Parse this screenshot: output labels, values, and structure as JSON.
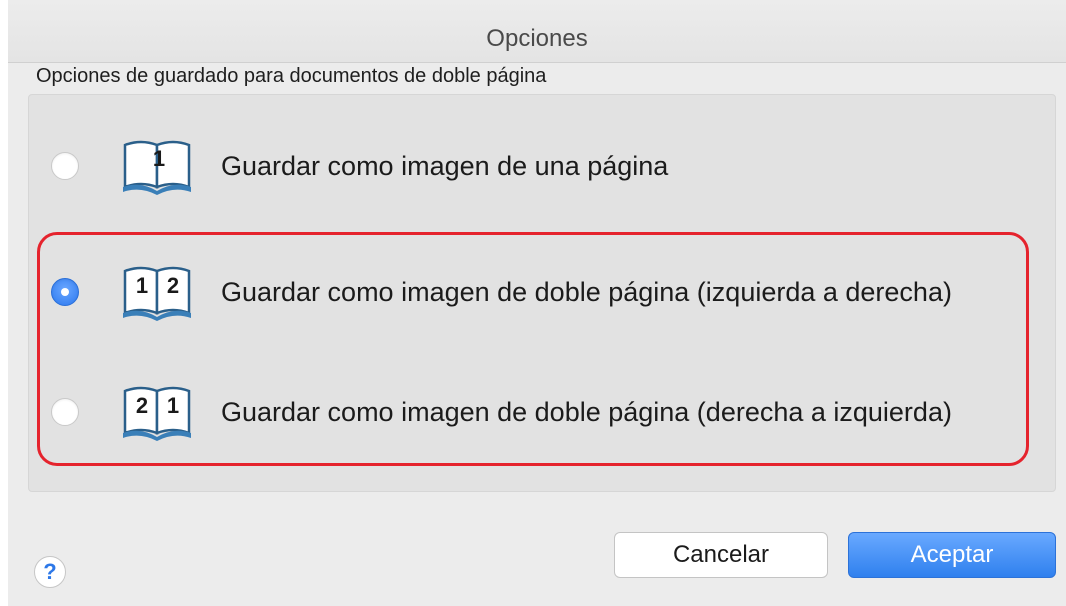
{
  "window": {
    "title": "Opciones"
  },
  "group": {
    "label": "Opciones de guardado para documentos de doble página"
  },
  "options": [
    {
      "label": "Guardar como imagen de una página",
      "selected": false,
      "icon": "book-single-page-icon",
      "page_numbers": [
        "1"
      ]
    },
    {
      "label": "Guardar como imagen de doble página (izquierda a derecha)",
      "selected": true,
      "icon": "book-double-page-left-to-right-icon",
      "page_numbers": [
        "1",
        "2"
      ]
    },
    {
      "label": "Guardar como imagen de doble página (derecha a izquierda)",
      "selected": false,
      "icon": "book-double-page-right-to-left-icon",
      "page_numbers": [
        "2",
        "1"
      ]
    }
  ],
  "buttons": {
    "help": "?",
    "cancel": "Cancelar",
    "accept": "Aceptar"
  },
  "colors": {
    "accent": "#2f80ee",
    "highlight_border": "#e5232d",
    "dialog_bg": "#ececec"
  }
}
